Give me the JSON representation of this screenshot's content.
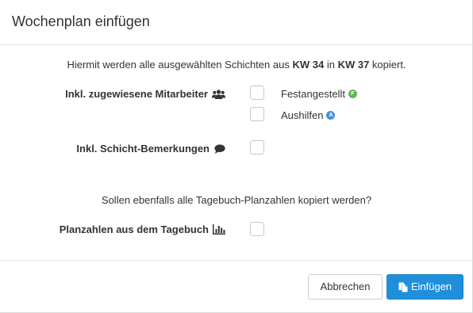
{
  "modal": {
    "title": "Wochenplan einfügen"
  },
  "info": {
    "prefix": "Hiermit werden alle ausgewählten Schichten aus",
    "from_week": "KW 34",
    "middle": "in",
    "to_week": "KW 37",
    "suffix": "kopiert."
  },
  "options": {
    "employees": {
      "label": "Inkl. zugewiesene Mitarbeiter",
      "icon": "users-icon",
      "choices": [
        {
          "label": "Festangestellt",
          "badge": "F",
          "badge_color": "#5cb85c",
          "checked": false
        },
        {
          "label": "Aushilfen",
          "badge": "A",
          "badge_color": "#4a90d9",
          "checked": false
        }
      ]
    },
    "remarks": {
      "label": "Inkl. Schicht-Bemerkungen",
      "icon": "comment-icon",
      "checked": false
    }
  },
  "diary": {
    "question": "Sollen ebenfalls alle Tagebuch-Planzahlen kopiert werden?",
    "label": "Planzahlen aus dem Tagebuch",
    "icon": "bar-chart-icon",
    "checked": false
  },
  "footer": {
    "cancel_label": "Abbrechen",
    "insert_label": "Einfügen",
    "insert_icon": "copy-icon",
    "accent_color": "#1f8fdb"
  }
}
